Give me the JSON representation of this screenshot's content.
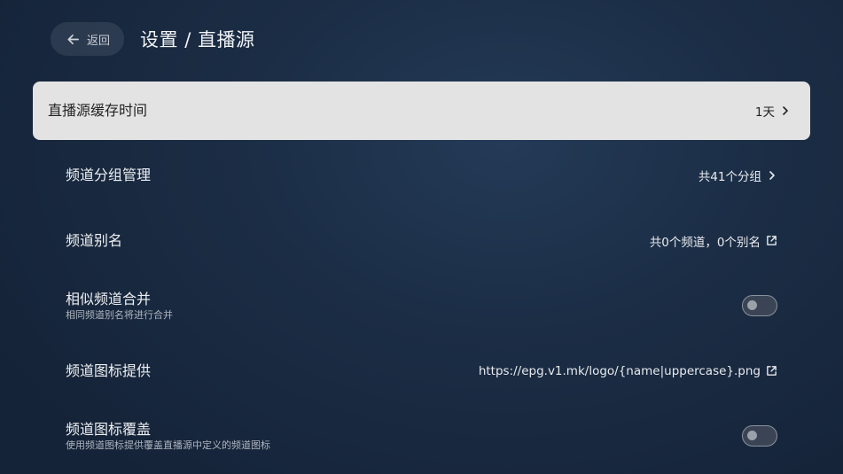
{
  "header": {
    "back_label": "返回",
    "title": "设置 / 直播源"
  },
  "settings": [
    {
      "title": "直播源缓存时间",
      "subtitle": "",
      "value": "1天",
      "control": "chevron",
      "focused": true
    },
    {
      "title": "频道分组管理",
      "subtitle": "",
      "value": "共41个分组",
      "control": "chevron",
      "focused": false
    },
    {
      "title": "频道别名",
      "subtitle": "",
      "value": "共0个频道，0个别名",
      "control": "external",
      "focused": false
    },
    {
      "title": "相似频道合并",
      "subtitle": "相同频道别名将进行合并",
      "value": "",
      "control": "toggle",
      "toggle_on": false,
      "focused": false
    },
    {
      "title": "频道图标提供",
      "subtitle": "",
      "value": "https://epg.v1.mk/logo/{name|uppercase}.png",
      "control": "external",
      "focused": false
    },
    {
      "title": "频道图标覆盖",
      "subtitle": "使用频道图标提供覆盖直播源中定义的频道图标",
      "value": "",
      "control": "toggle",
      "toggle_on": false,
      "focused": false
    }
  ],
  "icons": {
    "back": "arrow-left-icon",
    "chevron": "chevron-right-icon",
    "external": "external-link-icon"
  },
  "colors": {
    "focused_row_bg": "#e3e3e3",
    "background": "#1b2d45"
  }
}
